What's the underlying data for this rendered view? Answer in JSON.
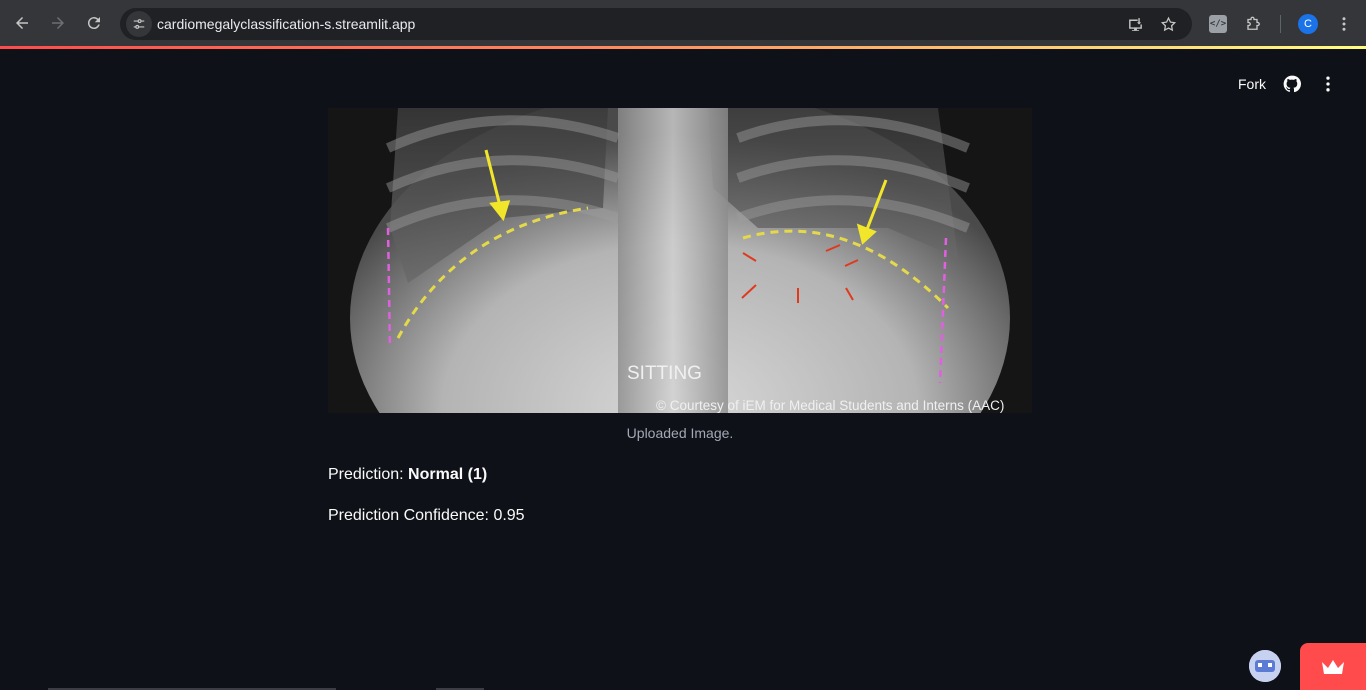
{
  "browser": {
    "url": "cardiomegalyclassification-s.streamlit.app",
    "profile_initial": "C",
    "icons": {
      "back": "arrow-left-icon",
      "forward": "arrow-right-icon",
      "reload": "reload-icon",
      "site_info": "tune-icon",
      "install": "install-app-icon",
      "bookmark": "star-icon",
      "devtools_ext": "code-extension-icon",
      "extensions": "puzzle-icon",
      "menu": "kebab-menu-icon"
    }
  },
  "app_header": {
    "fork_label": "Fork",
    "github_icon": "github-icon",
    "menu_icon": "kebab-menu-icon"
  },
  "main": {
    "image": {
      "overlay_label": "SITTING",
      "credit": "© Courtesy of iEM for Medical Students and Interns (AAC)"
    },
    "caption": "Uploaded Image.",
    "prediction_label": "Prediction:",
    "prediction_value": "Normal (1)",
    "confidence_label": "Prediction Confidence:",
    "confidence_value": "0.95"
  },
  "colors": {
    "app_bg": "#0e1117",
    "text": "#fafafa",
    "caption": "#a3a8b4",
    "accent": "#ff4b4b",
    "chrome": "#35363a"
  }
}
